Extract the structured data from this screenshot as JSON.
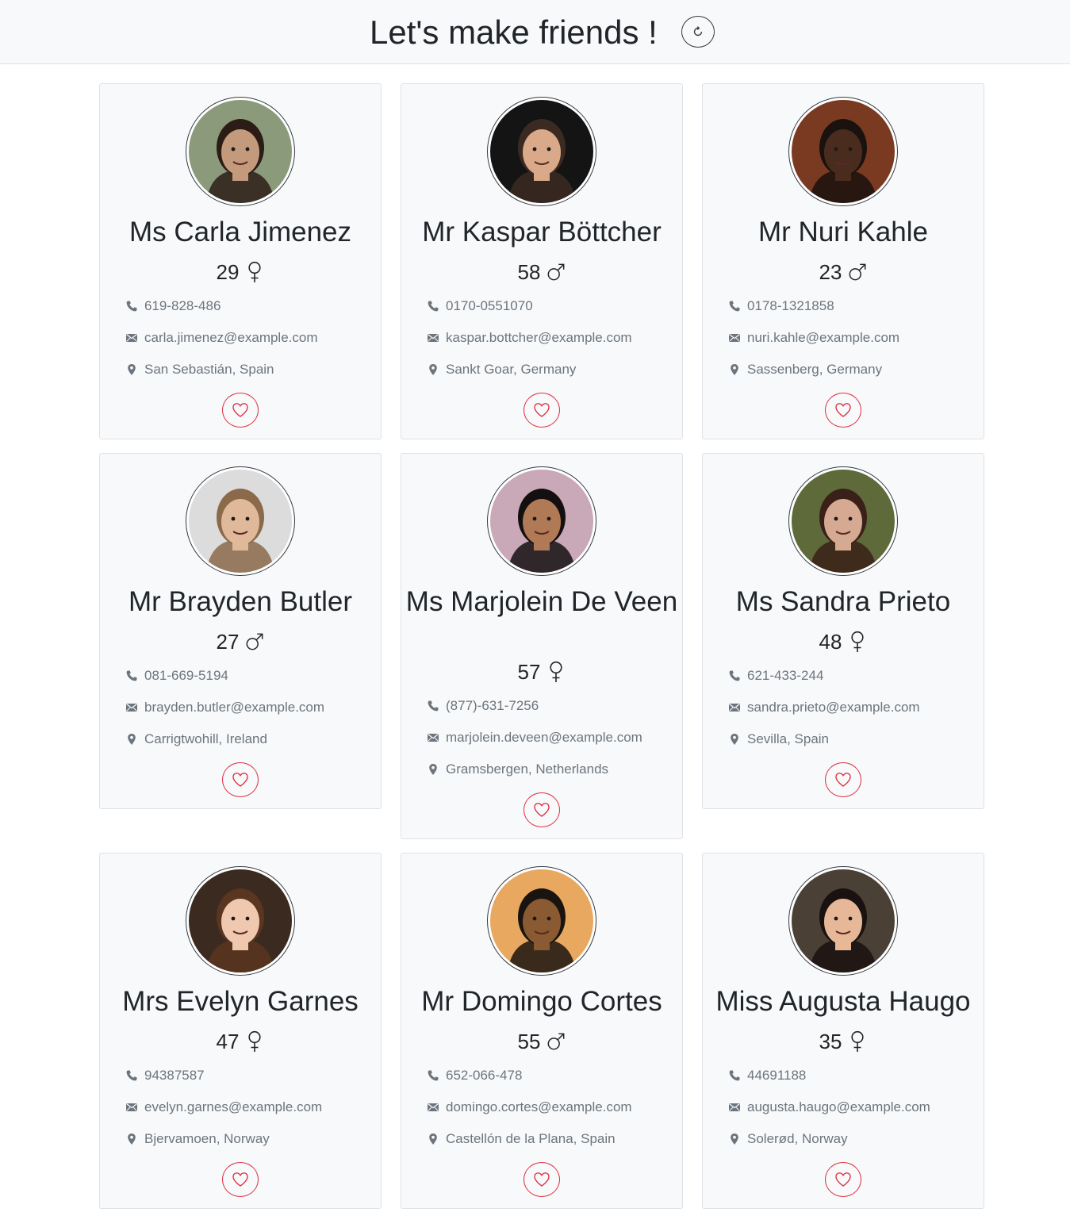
{
  "header": {
    "title": "Let's make friends !",
    "refresh_icon": "refresh-icon"
  },
  "colors": {
    "accent_like": "#dc3545",
    "muted_text": "#6c757d",
    "card_bg": "#f8f9fa"
  },
  "cards": [
    {
      "name": "Ms Carla Jimenez",
      "age": "29",
      "gender": "female",
      "phone": "619-828-486",
      "email": "carla.jimenez@example.com",
      "location": "San Sebastián, Spain",
      "avatar_tone": "#c49a7c",
      "avatar_bg": "#8a9a7a",
      "avatar_hair": "#2b1d16"
    },
    {
      "name": "Mr Kaspar Böttcher",
      "age": "58",
      "gender": "male",
      "phone": "0170-0551070",
      "email": "kaspar.bottcher@example.com",
      "location": "Sankt Goar, Germany",
      "avatar_tone": "#d9a98a",
      "avatar_bg": "#141414",
      "avatar_hair": "#3b2a22"
    },
    {
      "name": "Mr Nuri Kahle",
      "age": "23",
      "gender": "male",
      "phone": "0178-1321858",
      "email": "nuri.kahle@example.com",
      "location": "Sassenberg, Germany",
      "avatar_tone": "#4a2c1e",
      "avatar_bg": "#7a3a22",
      "avatar_hair": "#1a120e"
    },
    {
      "name": "Mr Brayden Butler",
      "age": "27",
      "gender": "male",
      "phone": "081-669-5194",
      "email": "brayden.butler@example.com",
      "location": "Carrigtwohill, Ireland",
      "avatar_tone": "#e0b89a",
      "avatar_bg": "#dcdcdc",
      "avatar_hair": "#8a6a4a"
    },
    {
      "name": "Ms Marjolein De Veen",
      "age": "57",
      "gender": "female",
      "phone": "(877)-631-7256",
      "email": "marjolein.deveen@example.com",
      "location": "Gramsbergen, Netherlands",
      "avatar_tone": "#b07a56",
      "avatar_bg": "#c9a8b8",
      "avatar_hair": "#141010"
    },
    {
      "name": "Ms Sandra Prieto",
      "age": "48",
      "gender": "female",
      "phone": "621-433-244",
      "email": "sandra.prieto@example.com",
      "location": "Sevilla, Spain",
      "avatar_tone": "#d6a992",
      "avatar_bg": "#5e6a3a",
      "avatar_hair": "#3a2018"
    },
    {
      "name": "Mrs Evelyn Garnes",
      "age": "47",
      "gender": "female",
      "phone": "94387587",
      "email": "evelyn.garnes@example.com",
      "location": "Bjervamoen, Norway",
      "avatar_tone": "#f0c8b0",
      "avatar_bg": "#3a2a20",
      "avatar_hair": "#5a3520"
    },
    {
      "name": "Mr Domingo Cortes",
      "age": "55",
      "gender": "male",
      "phone": "652-066-478",
      "email": "domingo.cortes@example.com",
      "location": "Castellón de la Plana, Spain",
      "avatar_tone": "#8a5a32",
      "avatar_bg": "#e8a860",
      "avatar_hair": "#1a1410"
    },
    {
      "name": "Miss Augusta Haugo",
      "age": "35",
      "gender": "female",
      "phone": "44691188",
      "email": "augusta.haugo@example.com",
      "location": "Solerød, Norway",
      "avatar_tone": "#e6b898",
      "avatar_bg": "#4a4036",
      "avatar_hair": "#1a1210"
    }
  ],
  "icons": {
    "phone": "phone-icon",
    "email": "envelope-icon",
    "location": "map-marker-icon",
    "like": "heart-icon",
    "female": "female-symbol-icon",
    "male": "male-symbol-icon"
  }
}
